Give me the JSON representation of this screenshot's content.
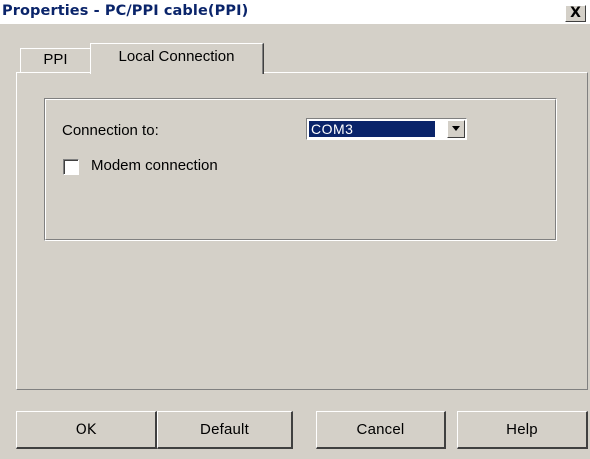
{
  "window": {
    "title": "Properties - PC/PPI cable(PPI)",
    "close_label": "X"
  },
  "tabs": [
    {
      "label": "PPI",
      "selected": false
    },
    {
      "label": "Local Connection",
      "selected": true
    }
  ],
  "local_connection": {
    "connection_label": "Connection to:",
    "connection_value": "COM3",
    "modem_label": "Modem connection",
    "modem_checked": false
  },
  "buttons": {
    "ok": "OK",
    "default": "Default",
    "cancel": "Cancel",
    "help": "Help"
  },
  "colors": {
    "face": "#d4d0c8",
    "title_text": "#0a246a",
    "selection": "#0a246a"
  }
}
